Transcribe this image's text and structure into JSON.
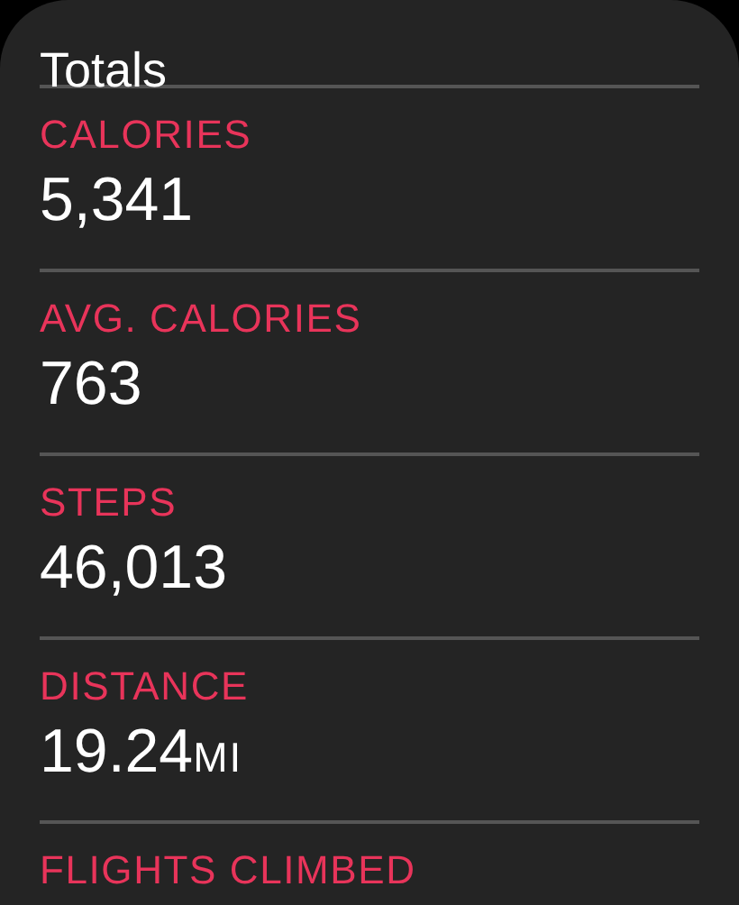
{
  "title": "Totals",
  "metrics": [
    {
      "label": "CALORIES",
      "value": "5,341"
    },
    {
      "label": "AVG. CALORIES",
      "value": "763"
    },
    {
      "label": "STEPS",
      "value": "46,013"
    },
    {
      "label": "DISTANCE",
      "value": "19.24",
      "unit": "MI"
    },
    {
      "label": "FLIGHTS CLIMBED"
    }
  ]
}
